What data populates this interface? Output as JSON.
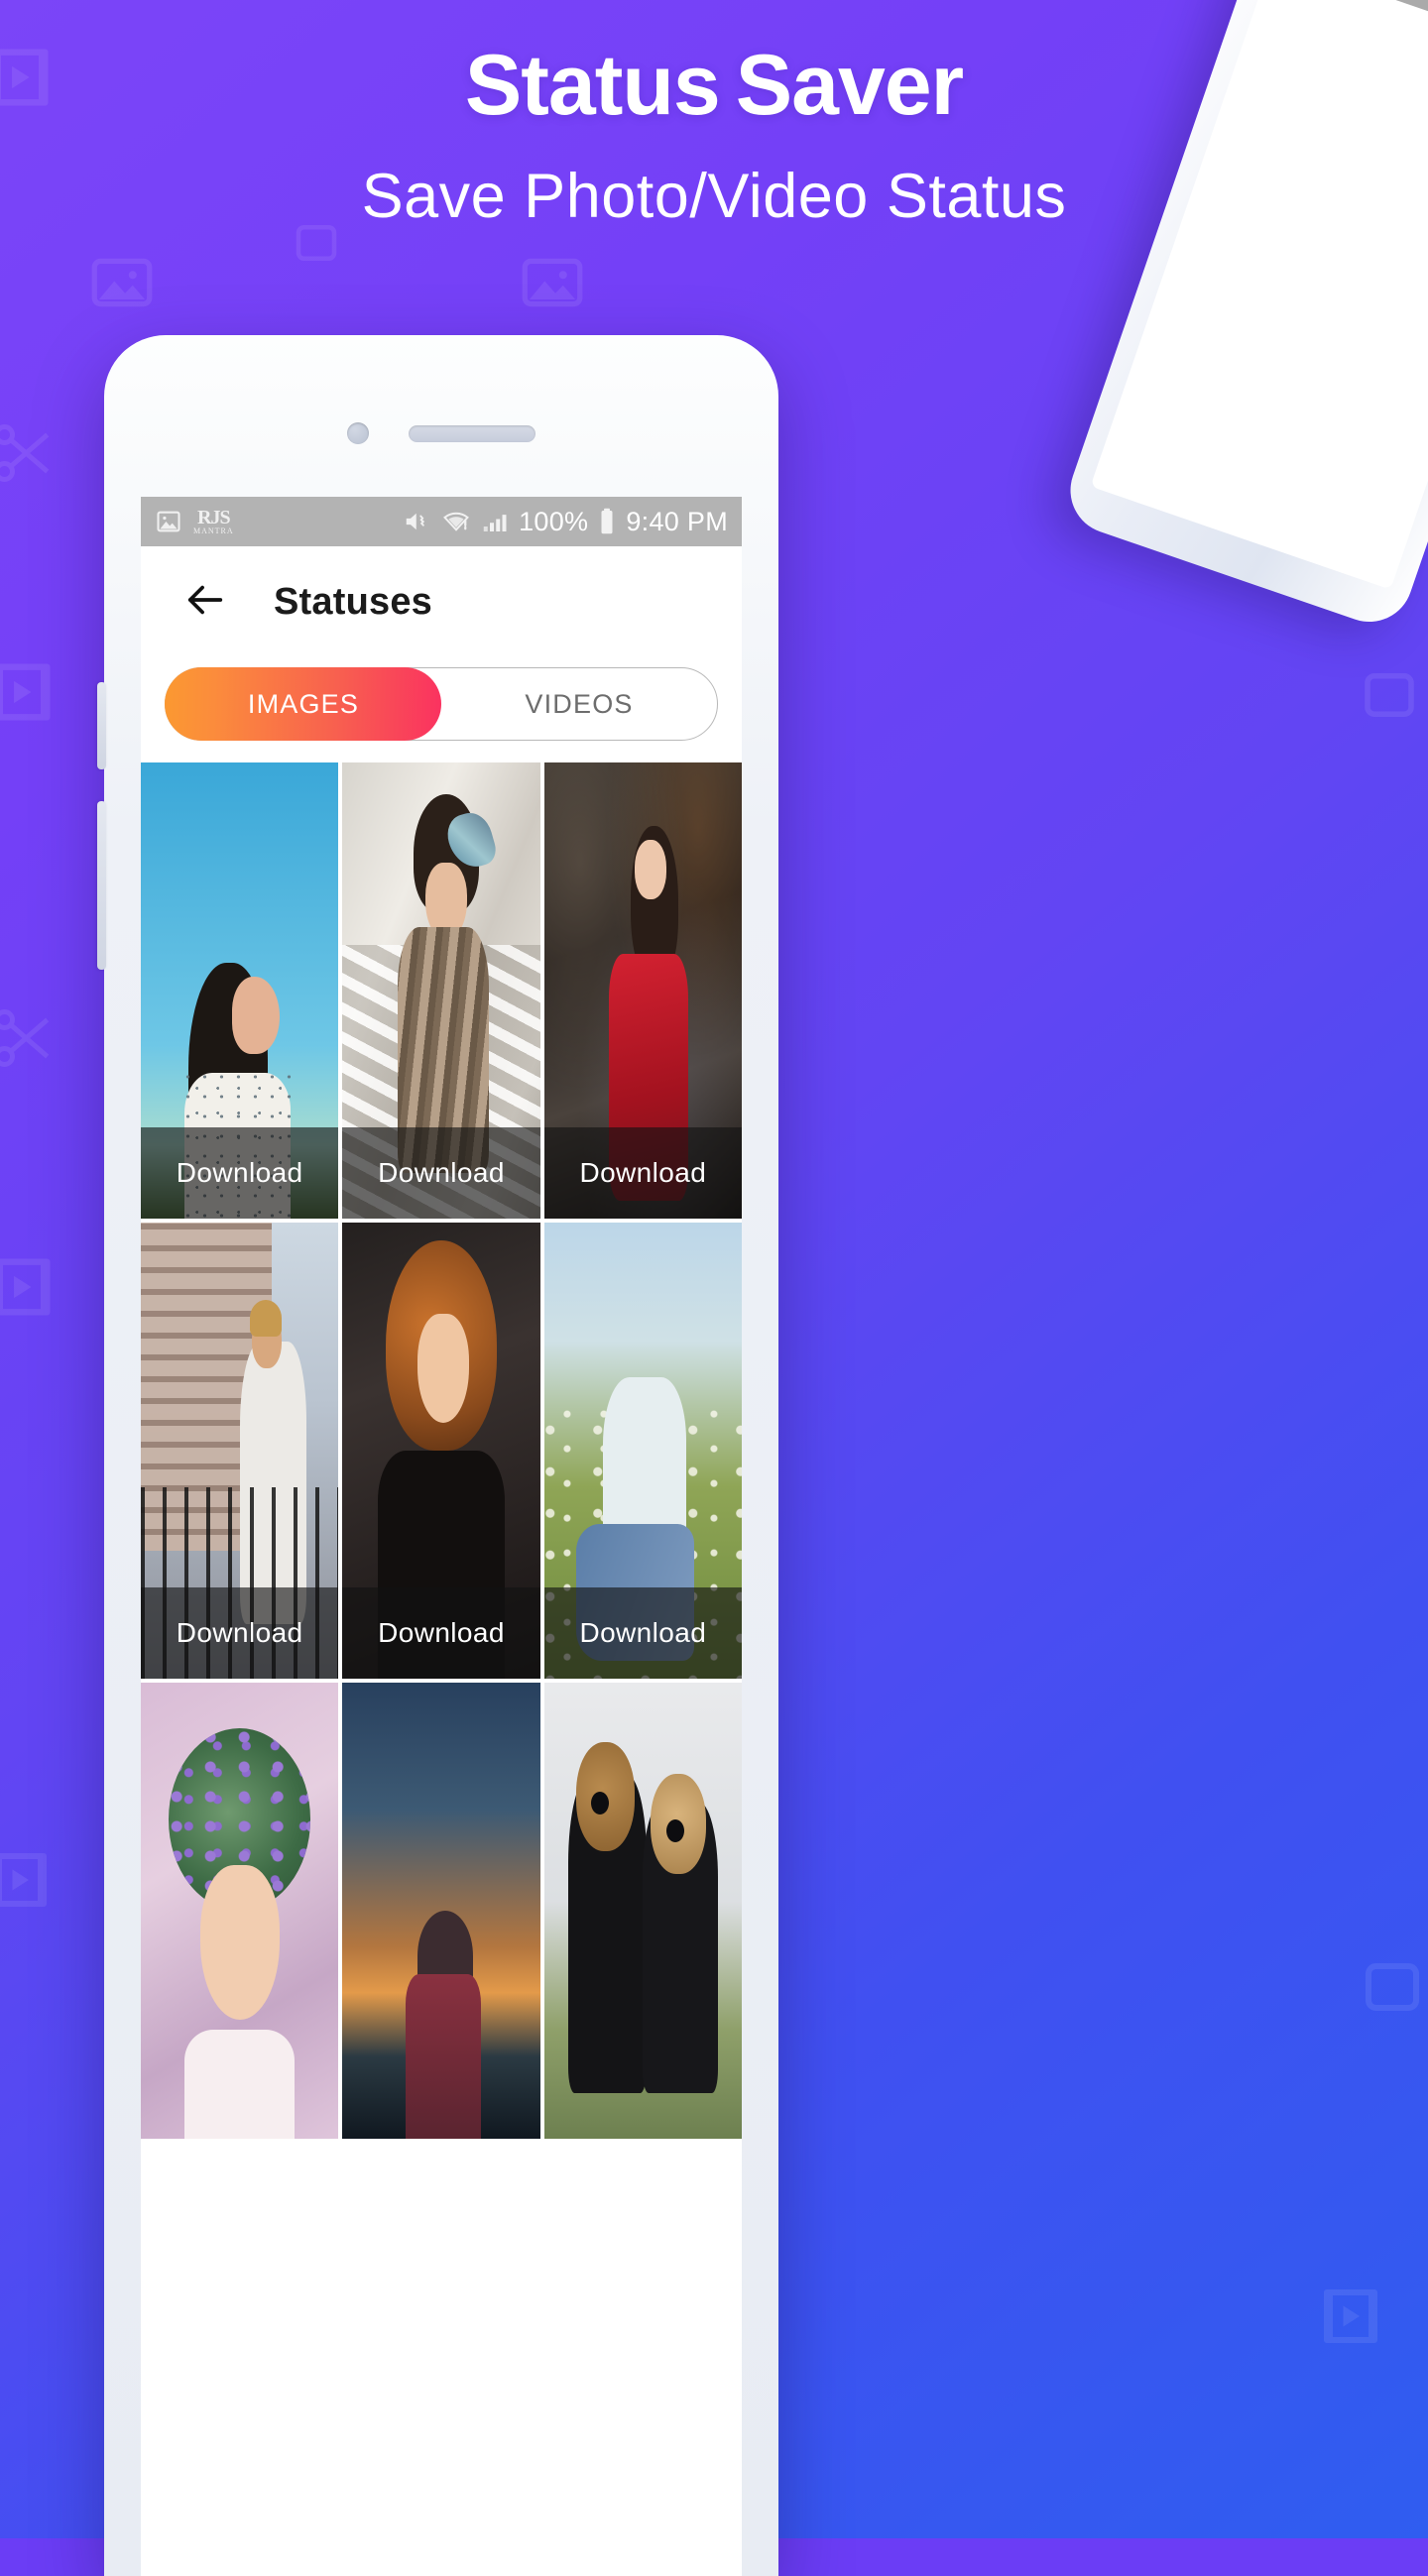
{
  "promo": {
    "title_part1": "Status",
    "title_part2": "Saver",
    "subtitle": "Save Photo/Video Status"
  },
  "colors": {
    "bg_from": "#7B45F8",
    "bg_to": "#2F5DF0",
    "tab_gradient_from": "#FB9931",
    "tab_gradient_to": "#FA3260",
    "statusbar": "#B3B3B3",
    "appbar_title": "#1B1B1B",
    "inactive_tab_text": "#6D6D6D"
  },
  "phone": {
    "statusbar": {
      "left_icons": [
        "image-icon",
        "app-logo-icon"
      ],
      "logo_text": "RJS",
      "logo_sub": "MANTRA",
      "mute_icon": "volume-mute-icon",
      "wifi_icon": "wifi-alert-icon",
      "signal_icon": "signal-bars-icon",
      "battery_percent": "100%",
      "battery_icon": "battery-full-icon",
      "time": "9:40 PM"
    },
    "appbar": {
      "back_icon": "back-arrow-icon",
      "title": "Statuses"
    },
    "tabs": [
      {
        "label": "IMAGES",
        "active": true
      },
      {
        "label": "VIDEOS",
        "active": false
      }
    ],
    "grid": {
      "download_label": "Download",
      "items": [
        {
          "art": "art-a",
          "caption": "Download",
          "alt": "woman-in-white-dress-blue-sky"
        },
        {
          "art": "art-b",
          "caption": "Download",
          "alt": "woman-with-headscarf-sunlight-blinds"
        },
        {
          "art": "art-c",
          "caption": "Download",
          "alt": "woman-in-red-dress-rocks"
        },
        {
          "art": "art-d",
          "caption": "Download",
          "alt": "man-on-fire-escape-stairs"
        },
        {
          "art": "art-e",
          "caption": "Download",
          "alt": "woman-with-curly-hair-dark"
        },
        {
          "art": "art-f",
          "caption": "Download",
          "alt": "woman-sitting-in-flower-field"
        },
        {
          "art": "art-g",
          "caption": "",
          "alt": "child-with-lavender-flower-crown"
        },
        {
          "art": "art-h",
          "caption": "",
          "alt": "person-in-hoodie-at-sunset"
        },
        {
          "art": "art-i",
          "caption": "",
          "alt": "couple-with-sunglasses-smiling"
        }
      ]
    }
  },
  "background_icons": [
    "play-icon",
    "image-icon",
    "video-icon",
    "scissors-icon",
    "square-icon"
  ]
}
